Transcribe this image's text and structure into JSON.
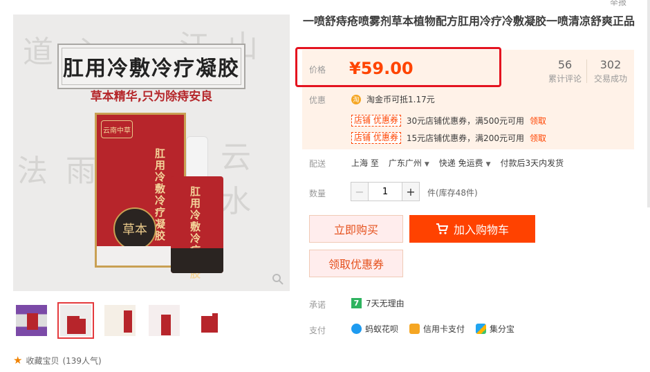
{
  "report_link": "举报",
  "product_image": {
    "headline": "肛用冷敷冷疗凝胶",
    "subline": "草本精华,只为除痔安良",
    "box_brand": "云南中草",
    "box_vertical_text": "肛用冷敷冷疗凝胶",
    "bottle_vertical_text": "肛用冷敷冷疗凝胶",
    "seal_text": "草本"
  },
  "thumbnails": [
    "thumb-1",
    "thumb-2",
    "thumb-3",
    "thumb-4",
    "thumb-5"
  ],
  "favorite": {
    "label": "收藏宝贝",
    "count": "(139人气)"
  },
  "title": "一喷舒痔疮喷雾剂草本植物配方肛用冷疗冷敷凝胶一喷清凉舒爽正品",
  "price": {
    "label": "价格",
    "value": "¥59.00"
  },
  "stats": [
    {
      "num": "56",
      "label": "累计评论"
    },
    {
      "num": "302",
      "label": "交易成功"
    }
  ],
  "promo": {
    "label": "优惠",
    "taojin": "淘金币可抵1.17元",
    "coupons": [
      {
        "tag": "店铺  优惠券",
        "text": "30元店铺优惠券，满500元可用",
        "action": "领取"
      },
      {
        "tag": "店铺  优惠券",
        "text": "15元店铺优惠券，满200元可用",
        "action": "领取"
      }
    ]
  },
  "delivery": {
    "label": "配送",
    "from": "上海 至",
    "to": "广东广州",
    "shipping": "快递 免运费",
    "note": "付款后3天内发货"
  },
  "quantity": {
    "label": "数量",
    "value": "1",
    "stock": "件(库存48件)"
  },
  "buttons": {
    "buy_now": "立即购买",
    "add_to_cart": "加入购物车",
    "get_coupon": "领取优惠券"
  },
  "promise": {
    "label": "承诺",
    "text": "7天无理由"
  },
  "payment": {
    "label": "支付",
    "methods": [
      "蚂蚁花呗",
      "信用卡支付",
      "集分宝"
    ]
  },
  "colors": {
    "accent": "#ff4200",
    "price": "#ff4400",
    "highlight_border": "#e4131f"
  }
}
